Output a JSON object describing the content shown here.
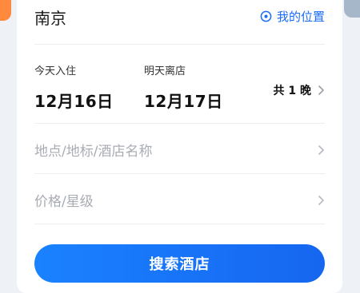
{
  "search": {
    "city": "南京",
    "my_location": "我的位置",
    "checkin_label": "今天入住",
    "checkin_date": "12月16日",
    "checkout_label": "明天离店",
    "checkout_date": "12月17日",
    "nights": "共 1 晚",
    "keyword_placeholder": "地点/地标/酒店名称",
    "price_star_placeholder": "价格/星级",
    "search_button": "搜索酒店"
  },
  "colors": {
    "accent": "#1a6cf5",
    "button_gradient_start": "#1a82ff",
    "button_gradient_end": "#1666f0",
    "placeholder_text": "#a8acb3"
  },
  "icons": {
    "location": "locate-target-icon",
    "chevron": "chevron-right-icon"
  }
}
